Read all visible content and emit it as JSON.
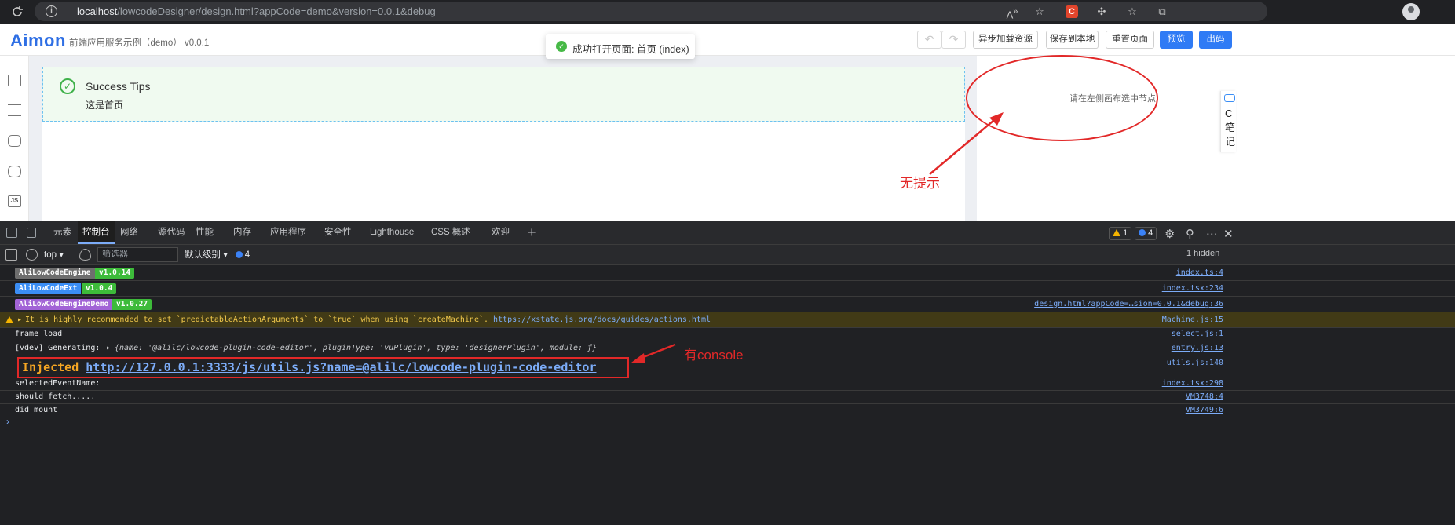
{
  "browser": {
    "url_host": "localhost",
    "url_path": "/lowcodeDesigner/design.html?appCode=demo&version=0.0.1&debug",
    "icons": [
      "reload-icon",
      "info-icon",
      "read-aloud-icon",
      "favorite-icon",
      "extension-icon",
      "puzzle-icon",
      "collections-icon",
      "tab-groups-icon",
      "profile-icon"
    ],
    "ext_letter": "C"
  },
  "designer": {
    "logo": "Aimon",
    "app_title": "前端应用服务示例（demo） v0.0.1",
    "undo_icon": "↶",
    "redo_icon": "↷",
    "buttons": {
      "async_load": "异步加载资源",
      "save_local": "保存到本地",
      "reset_page": "重置页面",
      "preview": "预览",
      "publish": "出码"
    },
    "toast": "成功打开页面: 首页 (index)",
    "alert": {
      "title": "Success Tips",
      "desc": "这是首页"
    },
    "right_panel_hint": "请在左侧画布选中节点",
    "annotation_no_hint": "无提示",
    "right_stub_text": "C\n笔\n记",
    "leftbar_js_label": "JS"
  },
  "devtools": {
    "tabs": [
      "元素",
      "控制台",
      "网络",
      "源代码",
      "性能",
      "内存",
      "应用程序",
      "安全性",
      "Lighthouse",
      "CSS 概述",
      "欢迎"
    ],
    "active_tab": "控制台",
    "warn_count": "1",
    "info_count": "4",
    "context": "top",
    "filter_placeholder": "筛选器",
    "level": "默认级别",
    "level_count": "4",
    "hidden": "1 hidden",
    "annotation_console": "有console",
    "logs": [
      {
        "name": "AliLowCodeEngine",
        "version": "v1.0.14",
        "color": "#6e6e6e",
        "src": "index.ts:4"
      },
      {
        "name": "AliLowCodeExt",
        "version": "v1.0.4",
        "color": "#3b8ef5",
        "src": "index.tsx:234"
      },
      {
        "name": "AliLowCodeEngineDemo",
        "version": "v1.0.27",
        "color": "#a263d6",
        "src": "design.html?appCode=…sion=0.0.1&debug:36"
      }
    ],
    "warning": {
      "text": "It is highly recommended to set `predictableActionArguments` to `true` when using `createMachine`.",
      "link": "https://xstate.js.org/docs/guides/actions.html",
      "src": "Machine.js:15"
    },
    "frame_load": {
      "text": "frame load",
      "src": "select.js:1"
    },
    "vdev": {
      "prefix": "[vdev] Generating:",
      "obj": "{name: '@alilc/lowcode-plugin-code-editor', pluginType: 'vuPlugin', type: 'designerPlugin', module: ƒ}",
      "src": "entry.js:13"
    },
    "injected": {
      "label": "Injected",
      "url": "http://127.0.0.1:3333/js/utils.js?name=@alilc/lowcode-plugin-code-editor",
      "src": "utils.js:140"
    },
    "tail": [
      {
        "text": "selectedEventName:",
        "src": "index.tsx:298"
      },
      {
        "text": "should fetch.....",
        "src": "VM3748:4"
      },
      {
        "text": "did mount",
        "src": "VM3749:6"
      }
    ],
    "prompt": "›"
  },
  "colors": {
    "accent": "#2f7bf5",
    "annotation": "#e22828",
    "success": "#3fb14a"
  }
}
